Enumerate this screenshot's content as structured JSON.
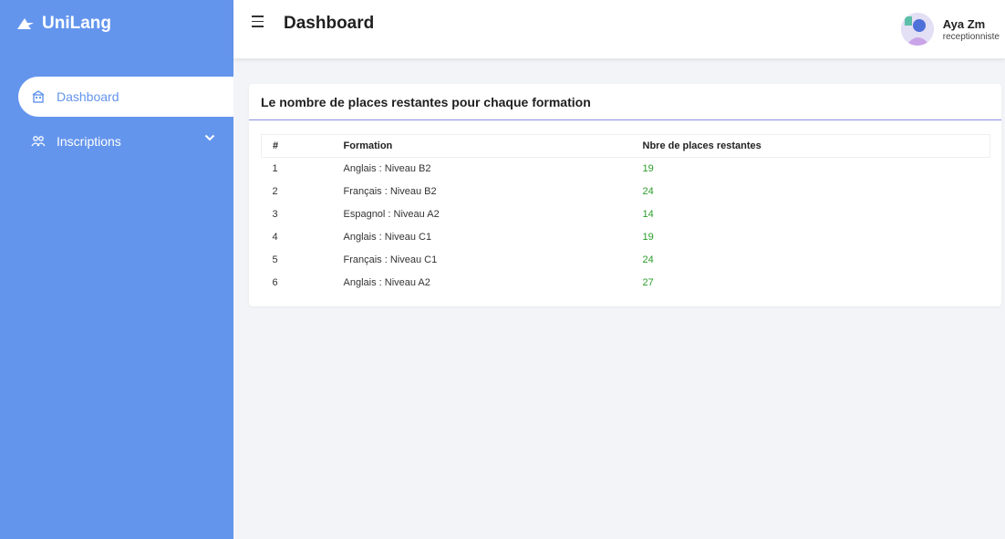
{
  "app": {
    "name": "UniLang",
    "logo_icon": "bird-logo-icon"
  },
  "sidebar": {
    "items": [
      {
        "label": "Dashboard",
        "icon": "building-icon",
        "active": true
      },
      {
        "label": "Inscriptions",
        "icon": "users-icon",
        "expandable": true
      }
    ]
  },
  "header": {
    "title": "Dashboard"
  },
  "user": {
    "name": "Aya Zm",
    "role": "receptionniste"
  },
  "card": {
    "title": "Le nombre de places restantes pour chaque formation",
    "columns": [
      "#",
      "Formation",
      "Nbre de places restantes"
    ],
    "rows": [
      {
        "n": "1",
        "formation": "Anglais : Niveau B2",
        "places": "19"
      },
      {
        "n": "2",
        "formation": "Français : Niveau B2",
        "places": "24"
      },
      {
        "n": "3",
        "formation": "Espagnol : Niveau A2",
        "places": "14"
      },
      {
        "n": "4",
        "formation": "Anglais : Niveau C1",
        "places": "19"
      },
      {
        "n": "5",
        "formation": "Français : Niveau C1",
        "places": "24"
      },
      {
        "n": "6",
        "formation": "Anglais : Niveau A2",
        "places": "27"
      }
    ]
  },
  "colors": {
    "sidebar": "#6495ed",
    "places_value": "#2a9d2a",
    "divider": "#8a8fe0"
  }
}
